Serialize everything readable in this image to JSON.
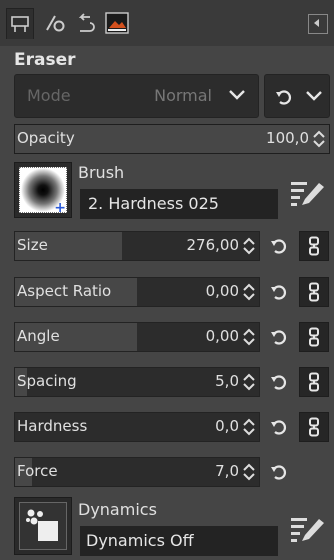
{
  "tool": {
    "title": "Eraser"
  },
  "mode": {
    "label": "Mode",
    "value": "Normal"
  },
  "opacity": {
    "label": "Opacity",
    "value": "100,0",
    "fraction": 1.0
  },
  "brush": {
    "label": "Brush",
    "name": "2. Hardness 025"
  },
  "sliders": [
    {
      "label": "Size",
      "value": "276,00",
      "fraction": 0.44
    },
    {
      "label": "Aspect Ratio",
      "value": "0,00",
      "fraction": 0.5
    },
    {
      "label": "Angle",
      "value": "0,00",
      "fraction": 0.5
    },
    {
      "label": "Spacing",
      "value": "5,0",
      "fraction": 0.05
    },
    {
      "label": "Hardness",
      "value": "0,0",
      "fraction": 0.0
    },
    {
      "label": "Force",
      "value": "7,0",
      "fraction": 0.07
    }
  ],
  "dynamics": {
    "label": "Dynamics",
    "name": "Dynamics Off"
  },
  "tabs": [
    {
      "icon": "tool-options-icon"
    },
    {
      "icon": "device-status-icon"
    },
    {
      "icon": "undo-history-icon"
    },
    {
      "icon": "images-icon"
    }
  ],
  "colors": {
    "panel": "#454545",
    "field": "#2c2c2c",
    "fill": "#474747",
    "brush_plus": "#2b5ad7"
  }
}
